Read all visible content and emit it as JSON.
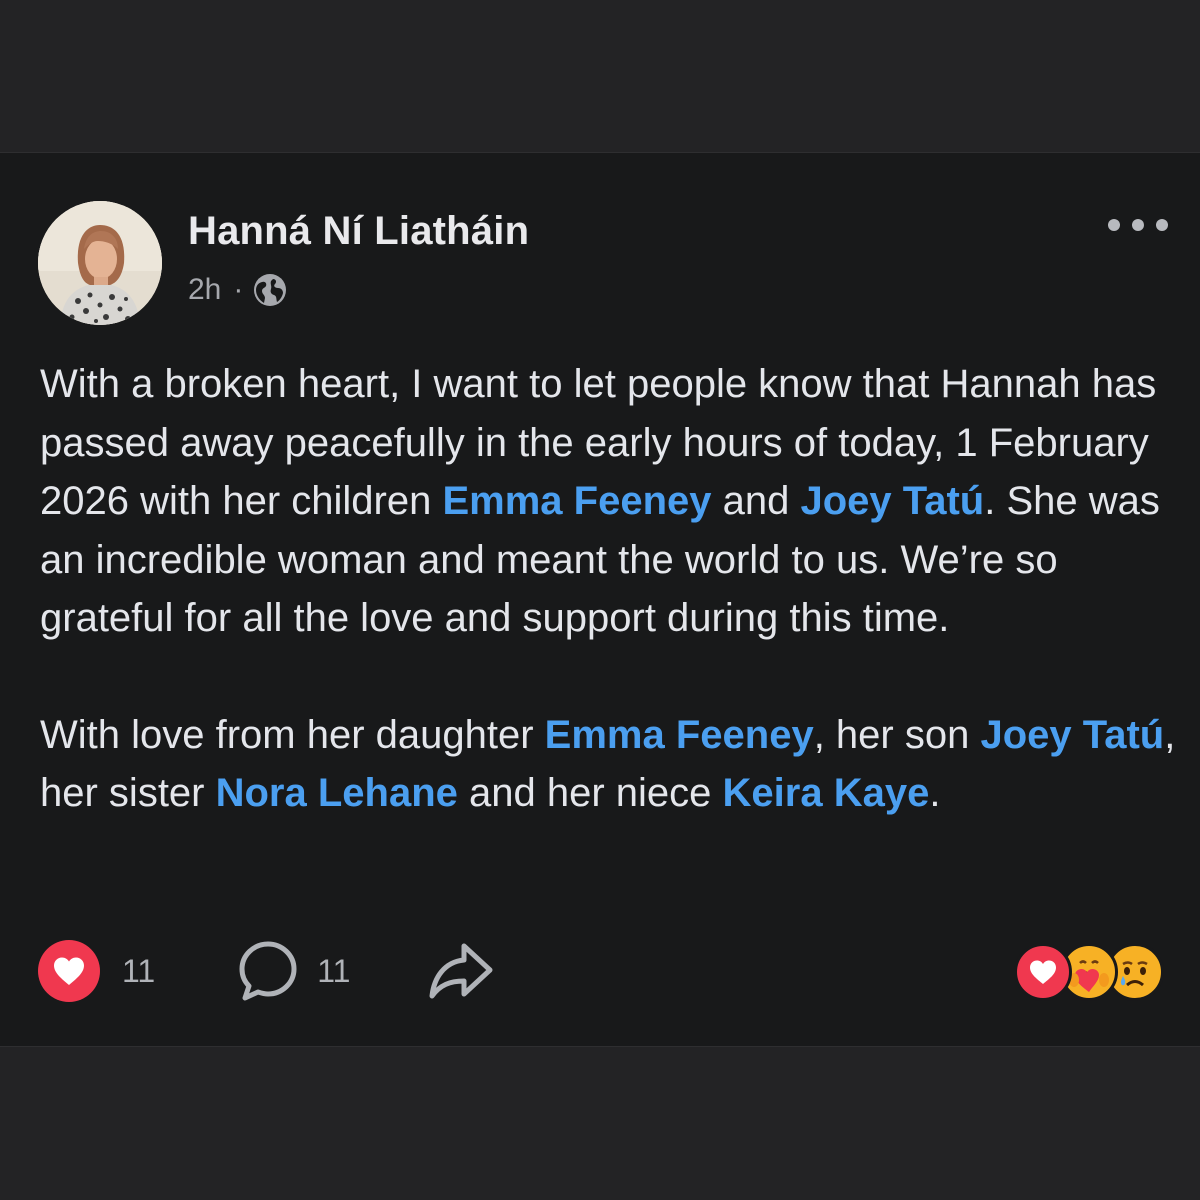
{
  "post": {
    "author": "Hanná Ní Liatháin",
    "time": "2h",
    "separator": "·",
    "visibility_icon": "globe-icon",
    "more_icon": "more-options-icon",
    "body": {
      "p1_a": "With a broken heart, I want to let people know that Hannah has passed away peacefully in the early hours of today, 1 February 2026 with her children ",
      "p1_m1": "Emma Feeney",
      "p1_b": " and ",
      "p1_m2": "Joey Tatú",
      "p1_c": ". She was an incredible woman and meant the world to us. We’re so grateful for all the love and support during this time.",
      "p2_a": "With love from her daughter ",
      "p2_m1": "Emma Feeney",
      "p2_b": ", her son ",
      "p2_m2": "Joey Tatú",
      "p2_c": ", her sister ",
      "p2_m3": "Nora Lehane",
      "p2_d": " and her niece ",
      "p2_m4": "Keira Kaye",
      "p2_e": "."
    },
    "actions": {
      "like_count": "11",
      "comment_count": "11"
    },
    "reactions": [
      "love",
      "care",
      "sad"
    ]
  },
  "colors": {
    "background": "#18191a",
    "text": "#e4e6eb",
    "mention": "#4b9ff0",
    "like": "#f0384f",
    "secondary": "#b0b3b8"
  }
}
